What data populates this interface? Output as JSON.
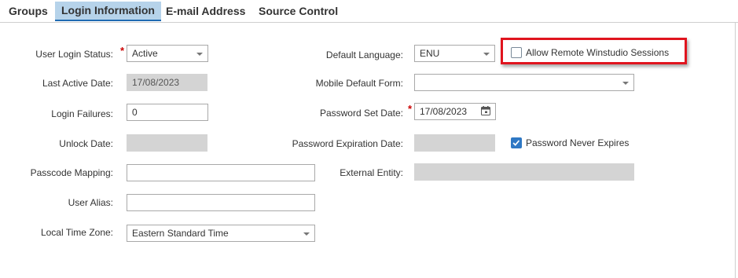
{
  "tabs": [
    {
      "label": "Groups",
      "active": false
    },
    {
      "label": "Login Information",
      "active": true
    },
    {
      "label": "E-mail Address",
      "active": false
    },
    {
      "label": "Source Control",
      "active": false
    }
  ],
  "form": {
    "user_login_status": {
      "label": "User Login Status:",
      "value": "Active",
      "required": true
    },
    "last_active_date": {
      "label": "Last Active Date:",
      "value": "17/08/2023"
    },
    "login_failures": {
      "label": "Login Failures:",
      "value": "0"
    },
    "unlock_date": {
      "label": "Unlock Date:",
      "value": ""
    },
    "passcode_mapping": {
      "label": "Passcode Mapping:",
      "value": ""
    },
    "user_alias": {
      "label": "User Alias:",
      "value": ""
    },
    "local_time_zone": {
      "label": "Local Time Zone:",
      "value": "Eastern Standard Time"
    },
    "default_language": {
      "label": "Default Language:",
      "value": "ENU"
    },
    "mobile_default_form": {
      "label": "Mobile Default Form:",
      "value": ""
    },
    "password_set_date": {
      "label": "Password Set Date:",
      "value": "17/08/2023",
      "required": true
    },
    "password_expiration_date": {
      "label": "Password Expiration Date:",
      "value": ""
    },
    "external_entity": {
      "label": "External Entity:",
      "value": ""
    },
    "allow_remote_winstudio": {
      "label": "Allow Remote Winstudio Sessions",
      "checked": false
    },
    "password_never_expires": {
      "label": "Password Never Expires",
      "checked": true
    }
  },
  "colors": {
    "active_tab_bg": "#b6d3ea",
    "highlight_border": "#e0141e",
    "checkbox_checked": "#2f78c4",
    "required_marker": "#cc0000"
  },
  "icons": {
    "calendar": "calendar-icon",
    "dropdown": "chevron-down-icon",
    "check": "checkmark-icon"
  }
}
